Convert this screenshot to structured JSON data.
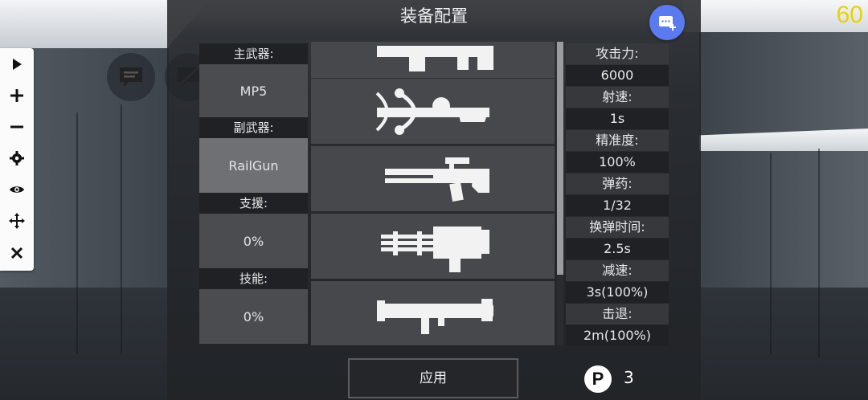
{
  "title": "装备配置",
  "fps": "60",
  "left_panel": {
    "primary_label": "主武器:",
    "primary_value": "MP5",
    "secondary_label": "副武器:",
    "secondary_value": "RailGun",
    "support_label": "支援:",
    "support_value": "0%",
    "skill_label": "技能:",
    "skill_value": "0%"
  },
  "weapons": [
    {
      "icon": "rifle-partial-icon"
    },
    {
      "icon": "crossbow-icon"
    },
    {
      "icon": "railgun-icon"
    },
    {
      "icon": "gatling-gun-icon"
    },
    {
      "icon": "rocket-launcher-icon"
    }
  ],
  "stats": [
    {
      "label": "攻击力:",
      "value": "6000"
    },
    {
      "label": "射速:",
      "value": "1s"
    },
    {
      "label": "精准度:",
      "value": "100%"
    },
    {
      "label": "弹药:",
      "value": "1/32"
    },
    {
      "label": "换弹时间:",
      "value": "2.5s"
    },
    {
      "label": "减速:",
      "value": "3s(100%)"
    },
    {
      "label": "击退:",
      "value": "2m(100%)"
    }
  ],
  "apply_label": "应用",
  "points": {
    "icon": "P",
    "value": "3"
  },
  "toolbar": [
    "play-icon",
    "plus-icon",
    "minus-icon",
    "gear-icon",
    "eye-icon",
    "move-icon",
    "close-icon"
  ],
  "colors": {
    "accent": "#5b7af0",
    "fps": "#e6d400"
  }
}
